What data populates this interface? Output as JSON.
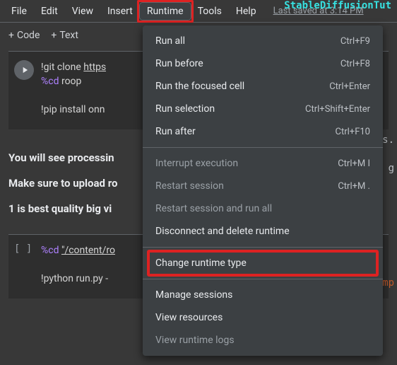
{
  "watermark": "StableDiffusionTut",
  "menubar": {
    "file": "File",
    "edit": "Edit",
    "view": "View",
    "insert": "Insert",
    "runtime": "Runtime",
    "tools": "Tools",
    "help": "Help",
    "last_saved": "Last saved at 3:14 PM"
  },
  "toolbar": {
    "code": "Code",
    "text": "Text"
  },
  "cell1": {
    "line1a": "!git clone ",
    "line1b": "https",
    "line2a": "%cd",
    "line2b": " roop",
    "line3": "!pip install onn"
  },
  "textblock": {
    "l1": "You will see processin",
    "l2": "Make sure to upload ro",
    "l3": "1 is best quality big vi"
  },
  "cell2": {
    "bracket": "[ ]",
    "line1a": "%cd",
    "line1b": " ",
    "line1c": "\"/content/ro",
    "line2": "!python run.py -"
  },
  "dropdown": {
    "items": [
      {
        "label": "Run all",
        "shortcut": "Ctrl+F9",
        "disabled": false
      },
      {
        "label": "Run before",
        "shortcut": "Ctrl+F8",
        "disabled": false
      },
      {
        "label": "Run the focused cell",
        "shortcut": "Ctrl+Enter",
        "disabled": false
      },
      {
        "label": "Run selection",
        "shortcut": "Ctrl+Shift+Enter",
        "disabled": false
      },
      {
        "label": "Run after",
        "shortcut": "Ctrl+F10",
        "disabled": false
      }
    ],
    "group2": [
      {
        "label": "Interrupt execution",
        "shortcut": "Ctrl+M I",
        "disabled": true
      },
      {
        "label": "Restart session",
        "shortcut": "Ctrl+M .",
        "disabled": true
      },
      {
        "label": "Restart session and run all",
        "shortcut": "",
        "disabled": true
      },
      {
        "label": "Disconnect and delete runtime",
        "shortcut": "",
        "disabled": false
      }
    ],
    "change": {
      "label": "Change runtime type"
    },
    "group3": [
      {
        "label": "Manage sessions",
        "disabled": false
      },
      {
        "label": "View resources",
        "disabled": false
      },
      {
        "label": "View runtime logs",
        "disabled": true
      }
    ]
  },
  "stray": {
    "s": "s.",
    "g": "g",
    "mp": "mp"
  }
}
